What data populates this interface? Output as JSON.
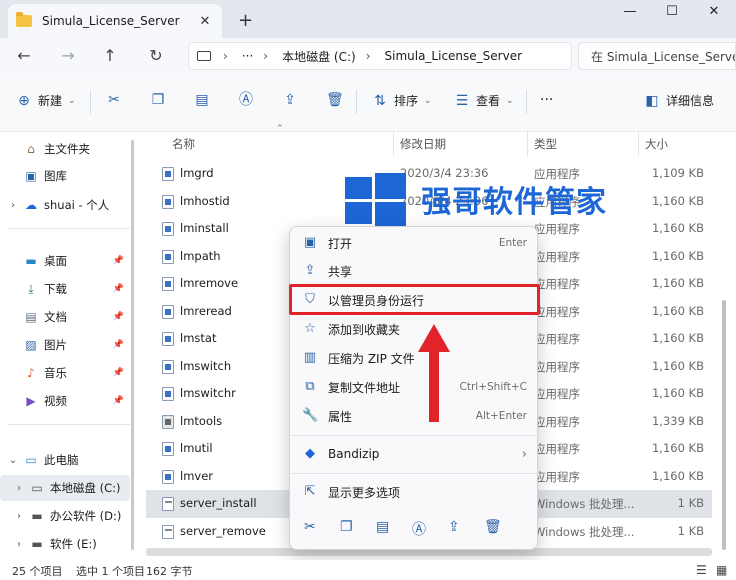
{
  "window": {
    "tab_title": "Simula_License_Server",
    "tab_close": "✕",
    "new_tab": "+",
    "minimize": "—",
    "maximize": "☐",
    "close": "✕"
  },
  "navbar": {
    "back": "←",
    "forward": "→",
    "up": "↑",
    "refresh": "↻",
    "breadcrumb": [
      "本地磁盘 (C:)",
      "Simula_License_Server"
    ],
    "overflow": "···",
    "search_placeholder": "在 Simula_License_Server"
  },
  "toolbar": {
    "new_label": "新建",
    "sort_label": "排序",
    "view_label": "查看",
    "more": "···",
    "details_label": "详细信息"
  },
  "sidebar": {
    "items": [
      {
        "label": "主文件夹",
        "icon": "home-icon"
      },
      {
        "label": "图库",
        "icon": "gallery-icon"
      },
      {
        "label": "shuai - 个人",
        "icon": "cloud-icon"
      },
      {
        "label": "桌面",
        "icon": "desktop-icon"
      },
      {
        "label": "下载",
        "icon": "download-icon"
      },
      {
        "label": "文档",
        "icon": "documents-icon"
      },
      {
        "label": "图片",
        "icon": "pictures-icon"
      },
      {
        "label": "音乐",
        "icon": "music-icon"
      },
      {
        "label": "视频",
        "icon": "videos-icon"
      },
      {
        "label": "此电脑",
        "icon": "pc-icon"
      },
      {
        "label": "本地磁盘 (C:)",
        "icon": "drive-icon"
      },
      {
        "label": "办公软件 (D:)",
        "icon": "drive-icon"
      },
      {
        "label": "软件 (E:)",
        "icon": "drive-icon"
      }
    ]
  },
  "list": {
    "columns": {
      "name": "名称",
      "date": "修改日期",
      "type": "类型",
      "size": "大小"
    },
    "rows": [
      {
        "name": "lmgrd",
        "date": "2020/3/4 23:36",
        "type": "应用程序",
        "size": "1,109 KB"
      },
      {
        "name": "lmhostid",
        "date": "2020/3/4 23:36",
        "type": "应用程序",
        "size": "1,160 KB"
      },
      {
        "name": "lminstall",
        "date": "",
        "type": "应用程序",
        "size": "1,160 KB"
      },
      {
        "name": "lmpath",
        "date": "",
        "type": "应用程序",
        "size": "1,160 KB"
      },
      {
        "name": "lmremove",
        "date": "",
        "type": "应用程序",
        "size": "1,160 KB"
      },
      {
        "name": "lmreread",
        "date": "",
        "type": "应用程序",
        "size": "1,160 KB"
      },
      {
        "name": "lmstat",
        "date": "",
        "type": "应用程序",
        "size": "1,160 KB"
      },
      {
        "name": "lmswitch",
        "date": "",
        "type": "应用程序",
        "size": "1,160 KB"
      },
      {
        "name": "lmswitchr",
        "date": "",
        "type": "应用程序",
        "size": "1,160 KB"
      },
      {
        "name": "lmtools",
        "date": "",
        "type": "应用程序",
        "size": "1,339 KB"
      },
      {
        "name": "lmutil",
        "date": "",
        "type": "应用程序",
        "size": "1,160 KB"
      },
      {
        "name": "lmver",
        "date": "",
        "type": "应用程序",
        "size": "1,160 KB"
      },
      {
        "name": "server_install",
        "date": "",
        "type": "Windows 批处理...",
        "size": "1 KB"
      },
      {
        "name": "server_remove",
        "date": "",
        "type": "Windows 批处理...",
        "size": "1 KB"
      }
    ]
  },
  "context_menu": {
    "items": [
      {
        "label": "打开",
        "shortcut": "Enter",
        "icon": "open-icon"
      },
      {
        "label": "共享",
        "shortcut": "",
        "icon": "share-icon"
      },
      {
        "label": "以管理员身份运行",
        "shortcut": "",
        "icon": "shield-icon"
      },
      {
        "label": "添加到收藏夹",
        "shortcut": "",
        "icon": "star-icon"
      },
      {
        "label": "压缩为 ZIP 文件",
        "shortcut": "",
        "icon": "zip-icon"
      },
      {
        "label": "复制文件地址",
        "shortcut": "Ctrl+Shift+C",
        "icon": "copy-path-icon"
      },
      {
        "label": "属性",
        "shortcut": "Alt+Enter",
        "icon": "wrench-icon"
      },
      {
        "label": "Bandizip",
        "shortcut": "",
        "icon": "bandizip-icon"
      },
      {
        "label": "显示更多选项",
        "shortcut": "",
        "icon": "more-options-icon"
      }
    ]
  },
  "watermark": {
    "text": "强哥软件管家"
  },
  "status": {
    "count": "25 个项目",
    "selected": "选中 1 个项目",
    "size": "162 字节"
  },
  "colors": {
    "accent": "#1d66d6",
    "highlight": "#e0242a",
    "selection": "#dfe3e8"
  }
}
